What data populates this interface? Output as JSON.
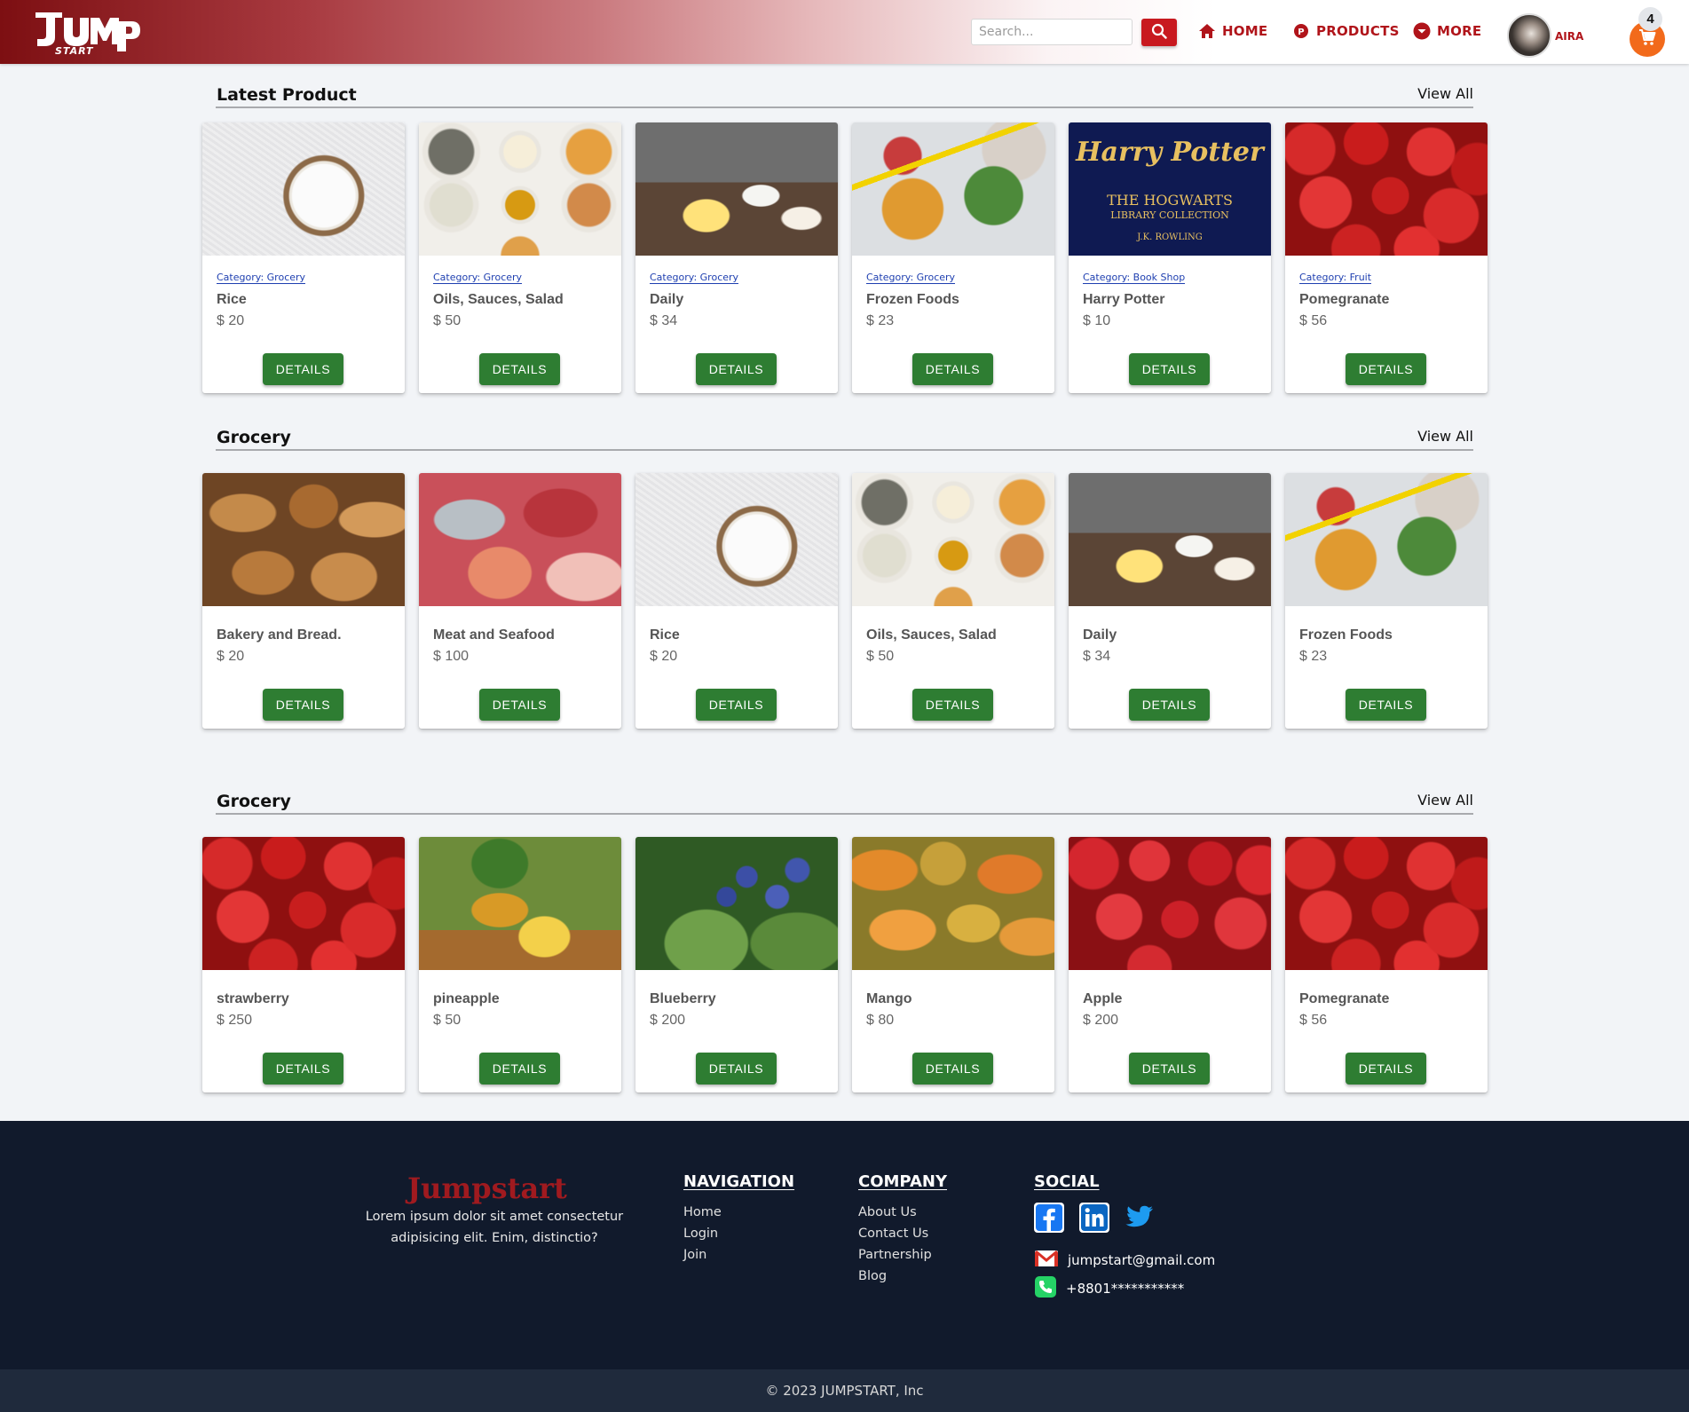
{
  "header": {
    "logo_top": "JUMP",
    "logo_bottom": "START",
    "search_placeholder": "Search...",
    "nav": {
      "home": "HOME",
      "products": "PRODUCTS",
      "more": "MORE"
    },
    "user_name": "AIRA",
    "cart_count": "4",
    "accent_color": "#c8191f"
  },
  "sections": [
    {
      "title": "Latest Product",
      "view_all": "View All",
      "cards": [
        {
          "image": "rice",
          "category_label": "Category:",
          "category": "Grocery",
          "name": "Rice",
          "price": "$ 20",
          "button": "DETAILS"
        },
        {
          "image": "oils",
          "category_label": "Category:",
          "category": "Grocery",
          "name": "Oils, Sauces, Salad",
          "price": "$ 50",
          "button": "DETAILS"
        },
        {
          "image": "daily",
          "category_label": "Category:",
          "category": "Grocery",
          "name": "Daily",
          "price": "$ 34",
          "button": "DETAILS"
        },
        {
          "image": "frozen",
          "category_label": "Category:",
          "category": "Grocery",
          "name": "Frozen Foods",
          "price": "$ 23",
          "button": "DETAILS"
        },
        {
          "image": "harry-potter",
          "category_label": "Category:",
          "category": "Book Shop",
          "name": "Harry Potter",
          "price": "$ 10",
          "button": "DETAILS"
        },
        {
          "image": "strawberry",
          "category_label": "Category:",
          "category": "Fruit",
          "name": "Pomegranate",
          "price": "$ 56",
          "button": "DETAILS"
        }
      ]
    },
    {
      "title": "Grocery",
      "view_all": "View All",
      "cards": [
        {
          "image": "bread",
          "name": "Bakery and Bread.",
          "price": "$ 20",
          "button": "DETAILS"
        },
        {
          "image": "meat",
          "name": "Meat and Seafood",
          "price": "$ 100",
          "button": "DETAILS"
        },
        {
          "image": "rice",
          "name": "Rice",
          "price": "$ 20",
          "button": "DETAILS"
        },
        {
          "image": "oils",
          "name": "Oils, Sauces, Salad",
          "price": "$ 50",
          "button": "DETAILS"
        },
        {
          "image": "daily",
          "name": "Daily",
          "price": "$ 34",
          "button": "DETAILS"
        },
        {
          "image": "frozen",
          "name": "Frozen Foods",
          "price": "$ 23",
          "button": "DETAILS"
        }
      ]
    },
    {
      "title": "Grocery",
      "view_all": "View All",
      "cards": [
        {
          "image": "strawberry",
          "name": "strawberry",
          "price": "$ 250",
          "button": "DETAILS"
        },
        {
          "image": "pineapple",
          "name": "pineapple",
          "price": "$ 50",
          "button": "DETAILS"
        },
        {
          "image": "blueberry",
          "name": "Blueberry",
          "price": "$ 200",
          "button": "DETAILS"
        },
        {
          "image": "mango",
          "name": "Mango",
          "price": "$ 80",
          "button": "DETAILS"
        },
        {
          "image": "apple",
          "name": "Apple",
          "price": "$ 200",
          "button": "DETAILS"
        },
        {
          "image": "strawberry",
          "name": "Pomegranate",
          "price": "$ 56",
          "button": "DETAILS"
        }
      ]
    }
  ],
  "hp_cover": {
    "title": "Harry Potter",
    "subtitle1": "THE HOGWARTS",
    "subtitle2": "LIBRARY COLLECTION",
    "author": "J.K. ROWLING"
  },
  "footer": {
    "brand": "Jumpstart",
    "description": "Lorem ipsum dolor sit amet consectetur adipisicing elit. Enim, distinctio?",
    "navigation_title": "NAVIGATION",
    "navigation_links": [
      "Home",
      "Login",
      "Join"
    ],
    "company_title": "COMPANY",
    "company_links": [
      "About Us",
      "Contact Us",
      "Partnership",
      "Blog"
    ],
    "social_title": "SOCIAL",
    "email": "jumpstart@gmail.com",
    "phone": "+8801***********",
    "copyright": "© 2023 JUMPSTART, Inc"
  }
}
